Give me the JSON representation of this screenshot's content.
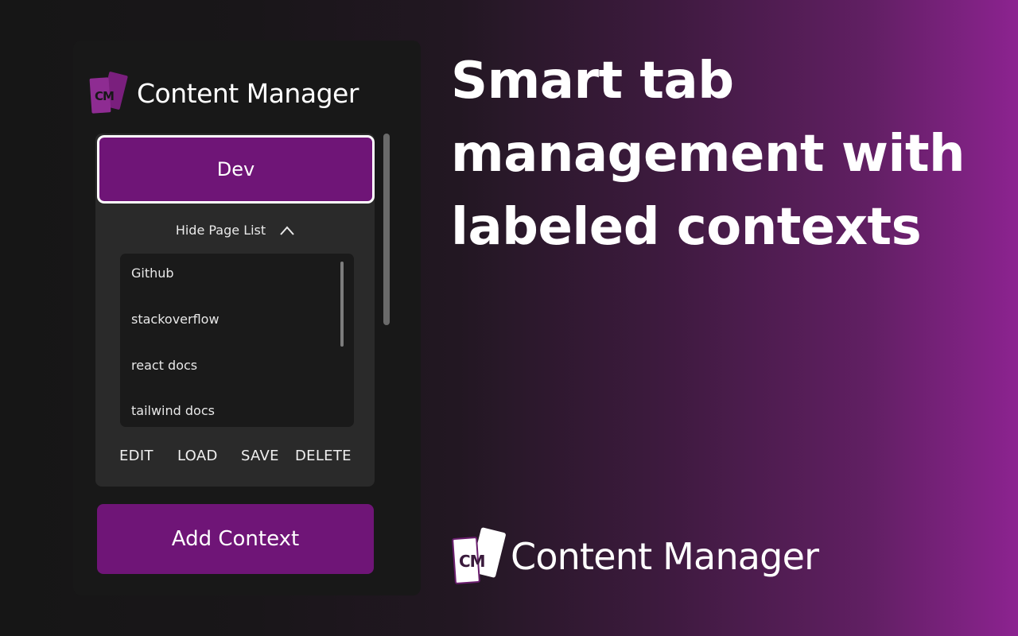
{
  "colors": {
    "accent": "#6f1577",
    "panel_bg": "#181818",
    "context_bg": "#2a2a2a",
    "list_bg": "#1a1a1a",
    "gradient_end": "#8c2390"
  },
  "popup": {
    "logo": {
      "icon": "cm-cards-logo",
      "mark": "CM"
    },
    "title": "Content Manager",
    "context": {
      "name": "Dev",
      "toggle_label": "Hide Page List",
      "toggle_icon": "chevron-up-icon",
      "pages": [
        {
          "title": "Github"
        },
        {
          "title": "stackoverflow"
        },
        {
          "title": "react docs"
        },
        {
          "title": "tailwind docs"
        }
      ],
      "actions": {
        "edit": "EDIT",
        "load": "LOAD",
        "save": "SAVE",
        "delete": "DELETE"
      }
    },
    "add_context_label": "Add Context"
  },
  "hero": {
    "headline_lines": [
      "Smart tab",
      "management with",
      "labeled contexts"
    ],
    "brand": {
      "logo": {
        "icon": "cm-cards-logo",
        "mark": "CM"
      },
      "title": "Content Manager"
    }
  }
}
